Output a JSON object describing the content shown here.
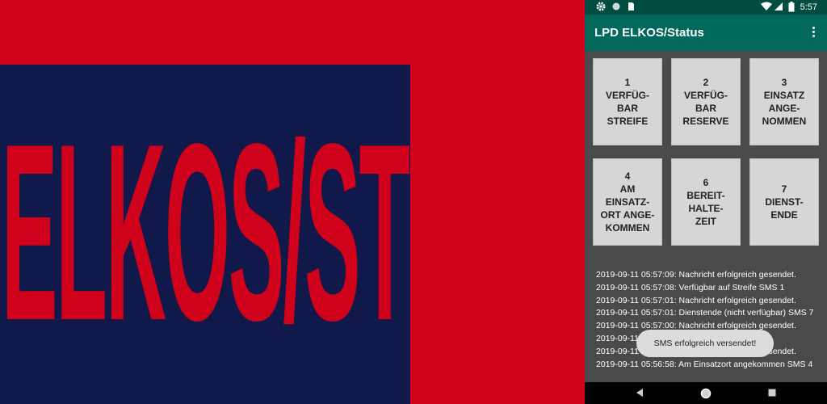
{
  "banner": {
    "text": "ELKOS/ST"
  },
  "statusbar": {
    "time": "5:57"
  },
  "app": {
    "title": "LPD ELKOS/Status"
  },
  "buttons": [
    {
      "label": "1\nVERFÜG-\nBAR\nSTREIFE"
    },
    {
      "label": "2\nVERFÜG-\nBAR\nRESERVE"
    },
    {
      "label": "3\nEINSATZ\nANGE-\nNOMMEN"
    },
    {
      "label": "4\nAM\nEINSATZ-\nORT ANGE-\nKOMMEN"
    },
    {
      "label": "6\nBEREIT-\nHALTE-\nZEIT"
    },
    {
      "label": "7\nDIENST-\nENDE"
    }
  ],
  "log": [
    "2019-09-11 05:57:09: Nachricht erfolgreich gesendet.",
    "2019-09-11 05:57:08: Verfügbar auf Streife SMS 1",
    "2019-09-11 05:57:01: Nachricht erfolgreich gesendet.",
    "2019-09-11 05:57:01: Dienstende (nicht verfügbar) SMS 7",
    "2019-09-11 05:57:00: Nachricht erfolgreich gesendet.",
    "2019-09-11 05:56:59: Bereithaltezeit SMS 6",
    "2019-09-11 05:56:58: Nachricht erfolgreich gesendet.",
    "2019-09-11 05:56:58: Am Einsatzort angekommen SMS 4"
  ],
  "toast": "SMS erfolgreich versendet!"
}
